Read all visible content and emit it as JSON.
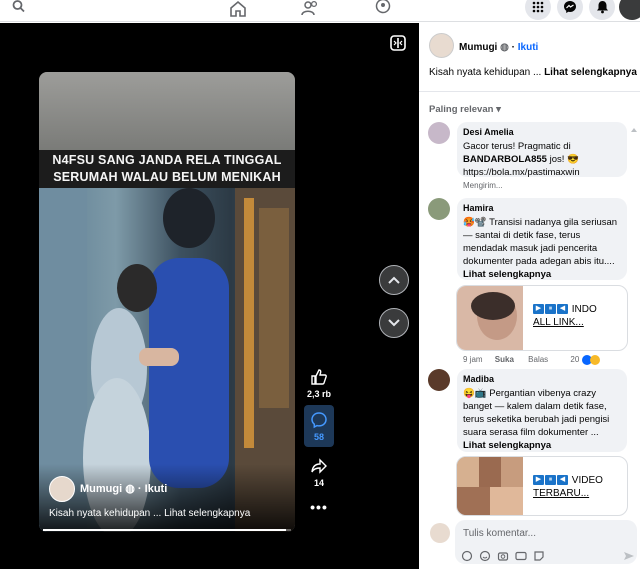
{
  "topbar": {
    "icons": [
      "search-icon",
      "home-icon",
      "friends-icon",
      "groups-icon",
      "menu-grid-icon",
      "messenger-icon",
      "notifications-icon",
      "profile-avatar"
    ]
  },
  "video": {
    "overlay_line1": "N4FSU SANG JANDA RELA TINGGAL",
    "overlay_line2": "SERUMAH WALAU BELUM MENIKAH",
    "author": "Mumugi",
    "follow": "Ikuti",
    "separator": "·",
    "caption": "Kisah nyata kehidupan ... Lihat selengkapnya",
    "progress": 0.98
  },
  "actions": {
    "likes": "2,3 rb",
    "comments": "58",
    "shares": "14"
  },
  "post": {
    "author": "Mumugi",
    "follow": "Ikuti",
    "caption_prefix": "Kisah nyata kehidupan ... ",
    "caption_more": "Lihat selengkapnya",
    "sort_label": "Paling relevan"
  },
  "comments": [
    {
      "author": "Desi Amelia",
      "line1": "Gacor terus! Pragmatic di",
      "line2_bold": "BANDARBOLA855",
      "line2_rest": " jos! 😎",
      "line3": "https://bola.mx/pastimaxwin",
      "status": "Mengirim..."
    },
    {
      "author": "Hamira",
      "text": "🥵📽️ Transisi nadanya gila seriusan — santai di detik fase, terus mendadak masuk jadi pencerita dokumenter pada adegan abis itu.... ",
      "more": "Lihat selengkapnya",
      "link_icons": "▶⏸◀",
      "link_title_1": " INDO",
      "link_title_2": "ALL LINK...",
      "time": "9 jam",
      "like": "Suka",
      "reply": "Balas",
      "reactions": "20"
    },
    {
      "author": "Madiba",
      "text": "😝📺 Pergantian vibenya crazy banget — kalem dalam detik fase, terus seketika berubah jadi pengisi suara serasa film dokumenter ... ",
      "more": "Lihat selengkapnya",
      "link_title_1": " VIDEO",
      "link_title_2": "TERBARU..."
    }
  ],
  "composer": {
    "placeholder": "Tulis komentar..."
  },
  "colors": {
    "accent": "#0866ff",
    "stage_bg": "#000000",
    "bubble_bg": "#f0f2f5"
  }
}
